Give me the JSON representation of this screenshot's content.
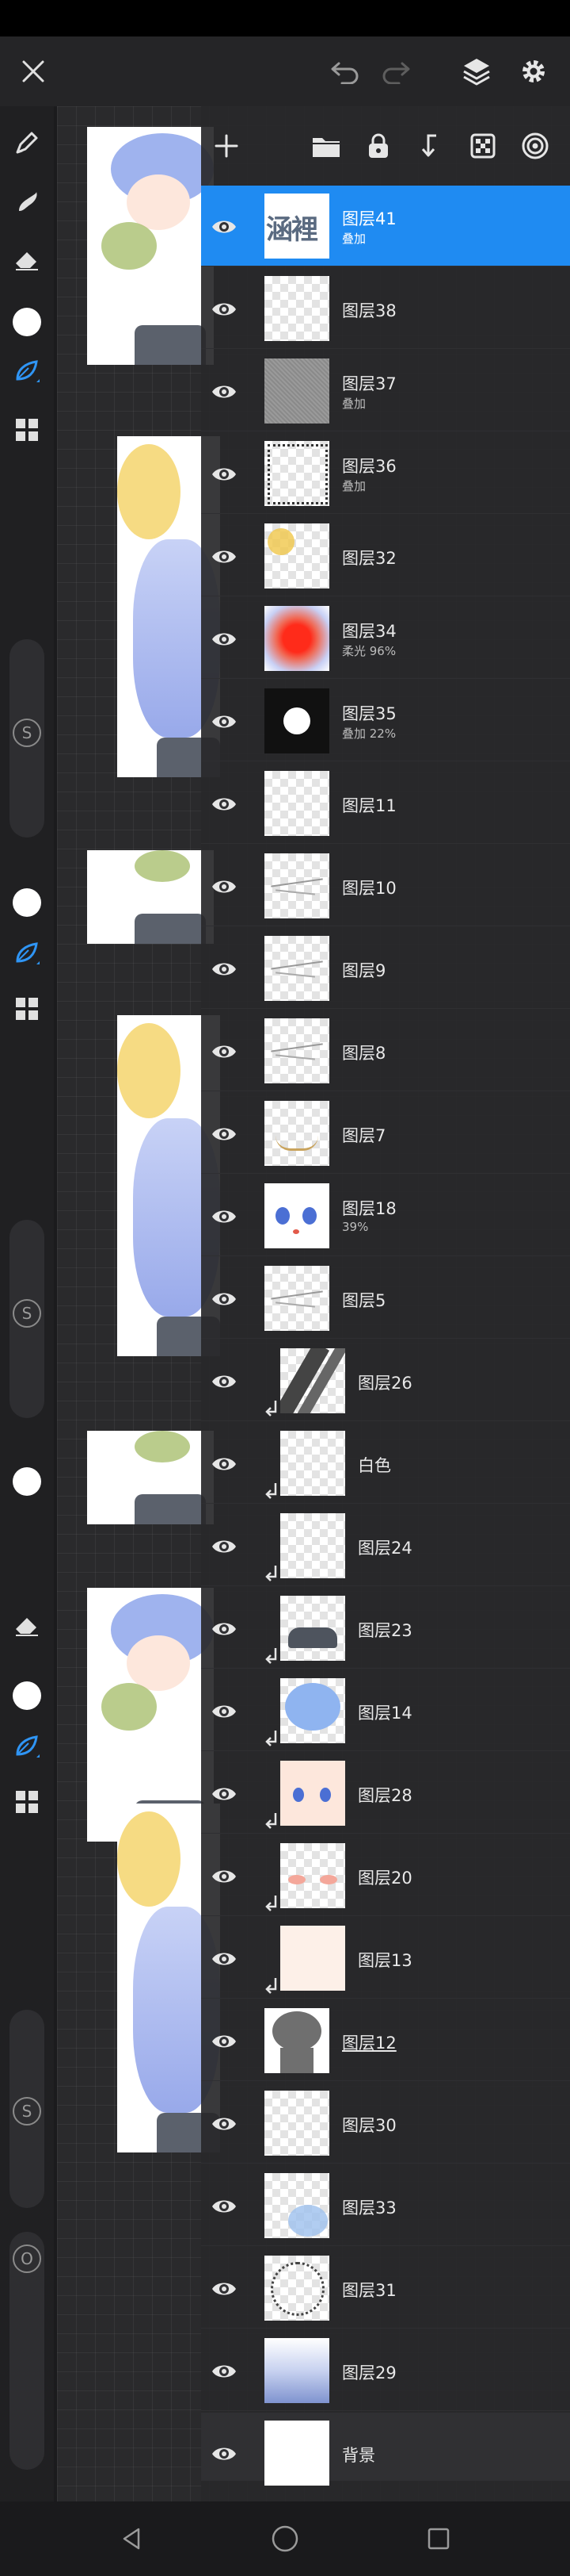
{
  "colors": {
    "accent": "#1f8bf2",
    "panel": "#28282a",
    "toolbar": "#202022"
  },
  "topbar": {
    "close_icon": "close-icon",
    "undo_icon": "undo-icon",
    "redo_icon": "redo-icon",
    "layers_icon": "layers-icon",
    "settings_icon": "gear-icon"
  },
  "toolbar": {
    "slider_symbol": "S",
    "opacity_symbol": "O",
    "tools": [
      "pen-icon",
      "smudge-icon",
      "eraser-icon",
      "color-swatch",
      "leaf-brush-icon",
      "grid-icon"
    ]
  },
  "layers_panel": {
    "add_icon": "plus-icon",
    "header_icons": [
      "folder-icon",
      "lock-icon",
      "merge-down-icon",
      "transparency-grid-icon",
      "target-icon"
    ],
    "layers": [
      {
        "name": "图层41",
        "mode": "叠加",
        "thumb_text": "涵裡",
        "active": true,
        "clipped": false,
        "thumb": "text"
      },
      {
        "name": "图层38",
        "mode": "",
        "active": false,
        "clipped": false,
        "thumb": "empty"
      },
      {
        "name": "图层37",
        "mode": "叠加",
        "active": false,
        "clipped": false,
        "thumb": "noise"
      },
      {
        "name": "图层36",
        "mode": "叠加",
        "active": false,
        "clipped": false,
        "thumb": "frame"
      },
      {
        "name": "图层32",
        "mode": "",
        "active": false,
        "clipped": false,
        "thumb": "yellow"
      },
      {
        "name": "图层34",
        "mode": "柔光 96%",
        "active": false,
        "clipped": false,
        "thumb": "redglow"
      },
      {
        "name": "图层35",
        "mode": "叠加 22%",
        "active": false,
        "clipped": false,
        "thumb": "dark"
      },
      {
        "name": "图层11",
        "mode": "",
        "active": false,
        "clipped": false,
        "thumb": "empty"
      },
      {
        "name": "图层10",
        "mode": "",
        "active": false,
        "clipped": false,
        "thumb": "sketch"
      },
      {
        "name": "图层9",
        "mode": "",
        "active": false,
        "clipped": false,
        "thumb": "sketch"
      },
      {
        "name": "图层8",
        "mode": "",
        "active": false,
        "clipped": false,
        "thumb": "sketch"
      },
      {
        "name": "图层7",
        "mode": "",
        "active": false,
        "clipped": false,
        "thumb": "line"
      },
      {
        "name": "图层18",
        "mode": "39%",
        "active": false,
        "clipped": false,
        "thumb": "eyes"
      },
      {
        "name": "图层5",
        "mode": "",
        "active": false,
        "clipped": false,
        "thumb": "sketch"
      },
      {
        "name": "图层26",
        "mode": "",
        "active": false,
        "clipped": true,
        "thumb": "stripe"
      },
      {
        "name": "白色",
        "mode": "",
        "active": false,
        "clipped": true,
        "thumb": "empty"
      },
      {
        "name": "图层24",
        "mode": "",
        "active": false,
        "clipped": true,
        "thumb": "empty"
      },
      {
        "name": "图层23",
        "mode": "",
        "active": false,
        "clipped": true,
        "thumb": "coat"
      },
      {
        "name": "图层14",
        "mode": "",
        "active": false,
        "clipped": true,
        "thumb": "bluehair"
      },
      {
        "name": "图层28",
        "mode": "",
        "active": false,
        "clipped": true,
        "thumb": "face"
      },
      {
        "name": "图层20",
        "mode": "",
        "active": false,
        "clipped": true,
        "thumb": "blush"
      },
      {
        "name": "图层13",
        "mode": "",
        "active": false,
        "clipped": true,
        "thumb": "skin"
      },
      {
        "name": "图层12",
        "mode": "",
        "active": false,
        "clipped": false,
        "thumb": "silhouette",
        "underline": true
      },
      {
        "name": "图层30",
        "mode": "",
        "active": false,
        "clipped": false,
        "thumb": "empty"
      },
      {
        "name": "图层33",
        "mode": "",
        "active": false,
        "clipped": false,
        "thumb": "bluefloor"
      },
      {
        "name": "图层31",
        "mode": "",
        "active": false,
        "clipped": false,
        "thumb": "ring"
      },
      {
        "name": "图层29",
        "mode": "",
        "active": false,
        "clipped": false,
        "thumb": "gradient"
      },
      {
        "name": "背景",
        "mode": "",
        "active": false,
        "clipped": false,
        "thumb": "white",
        "background": true
      }
    ]
  },
  "navbar": {
    "back_icon": "back-icon",
    "home_icon": "home-icon",
    "recents_icon": "recents-icon"
  }
}
